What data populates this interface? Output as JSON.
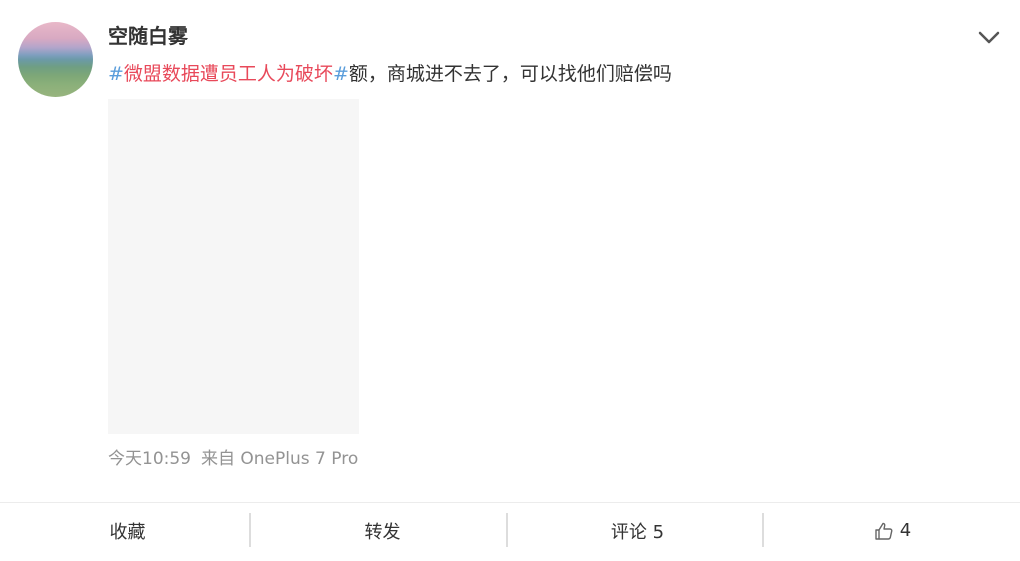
{
  "post": {
    "username": "空随白雾",
    "hashtag_open": "#",
    "topic": "微盟数据遭员工人为破坏",
    "hashtag_close": "#",
    "body": "额，商城进不去了，可以找他们赔偿吗",
    "time": "今天10:59",
    "source": "来自 OnePlus 7 Pro"
  },
  "actions": {
    "favorite_label": "收藏",
    "repost_label": "转发",
    "comment_label": "评论 5",
    "like_count": "4"
  },
  "icons": {
    "menu": "chevron-down-icon",
    "like": "thumbs-up-icon"
  },
  "colors": {
    "hashtag": "#5a9ddb",
    "topic": "#e8495a",
    "meta": "#939393",
    "image_placeholder": "#f6f6f6"
  }
}
